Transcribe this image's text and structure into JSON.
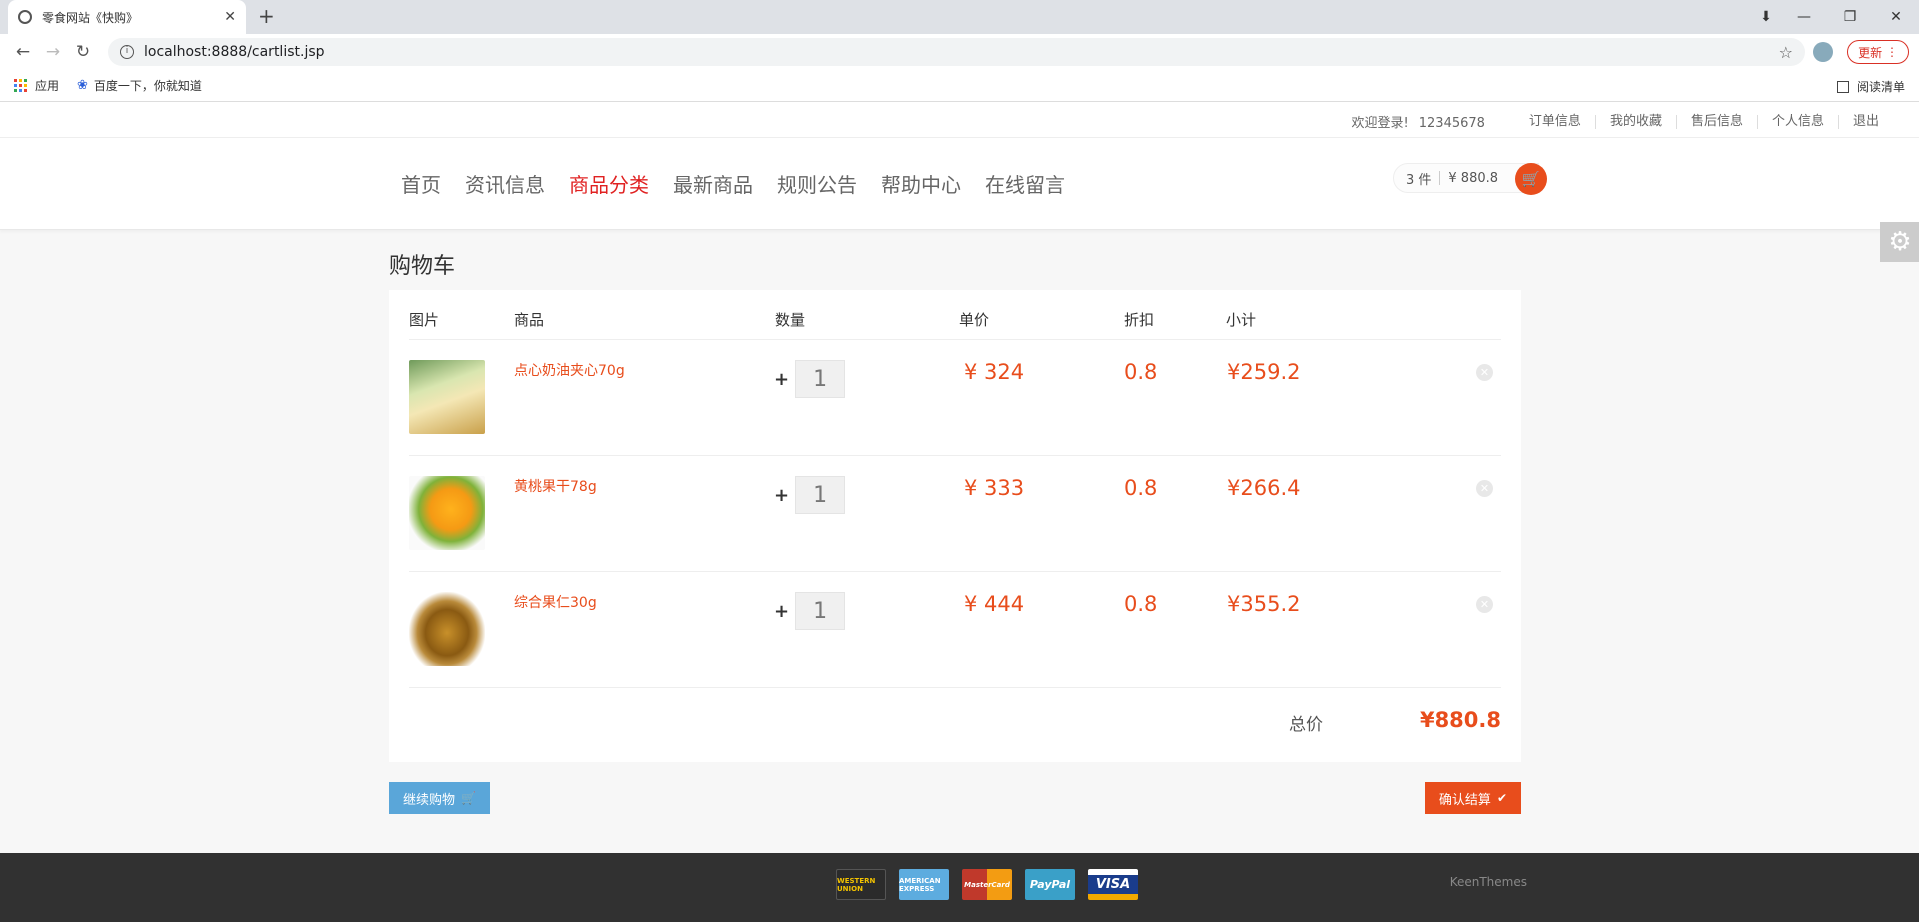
{
  "browser": {
    "tab_title": "零食网站《快购》",
    "url": "localhost:8888/cartlist.jsp",
    "update_label": "更新",
    "bookmarks": [
      "应用",
      "百度一下，你就知道"
    ],
    "reading_list": "阅读清单"
  },
  "topbar": {
    "welcome": "欢迎登录!",
    "username": "12345678",
    "links": [
      "订单信息",
      "我的收藏",
      "售后信息",
      "个人信息",
      "退出"
    ]
  },
  "nav": {
    "items": [
      "首页",
      "资讯信息",
      "商品分类",
      "最新商品",
      "规则公告",
      "帮助中心",
      "在线留言"
    ],
    "active": "商品分类"
  },
  "cart_widget": {
    "count": "3 件",
    "total": "¥ 880.8"
  },
  "page_title": "购物车",
  "table": {
    "headers": [
      "图片",
      "商品",
      "数量",
      "单价",
      "折扣",
      "小计"
    ],
    "rows": [
      {
        "name": "点心奶油夹心70g",
        "qty": "1",
        "price": "¥ 324",
        "discount": "0.8",
        "subtotal": "¥259.2",
        "thumb_color": "#c9b060"
      },
      {
        "name": "黄桃果干78g",
        "qty": "1",
        "price": "¥ 333",
        "discount": "0.8",
        "subtotal": "¥266.4",
        "thumb_color": "#f39a1e"
      },
      {
        "name": "综合果仁30g",
        "qty": "1",
        "price": "¥ 444",
        "discount": "0.8",
        "subtotal": "¥355.2",
        "thumb_color": "#b07a20"
      }
    ]
  },
  "total": {
    "label": "总价",
    "value": "¥880.8"
  },
  "buttons": {
    "continue": "继续购物",
    "confirm": "确认结算"
  },
  "footer": {
    "cards": [
      "WESTERN UNION",
      "AMERICAN EXPRESS",
      "MasterCard",
      "PayPal",
      "VISA"
    ],
    "brand": "KeenThemes"
  },
  "colors": {
    "accent": "#e84d1c",
    "nav_active": "#e02222",
    "continue_btn": "#5aa6d9"
  }
}
